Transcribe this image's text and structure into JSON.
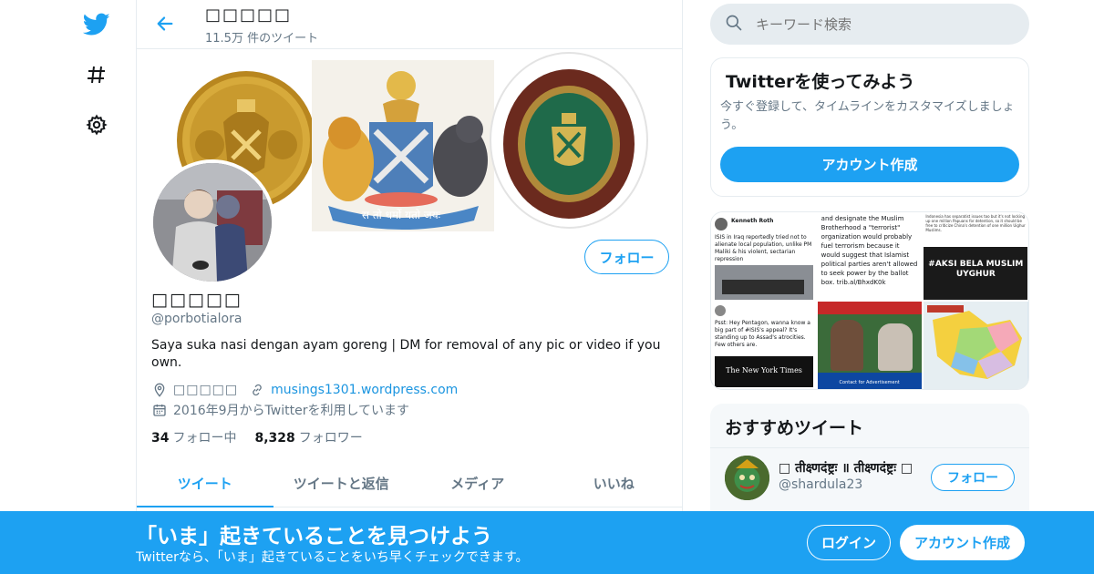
{
  "nav": {
    "items": [
      "twitter-logo",
      "explore-hashtag",
      "settings"
    ]
  },
  "header": {
    "name": "□□□□□",
    "tweet_count": "11.5万 件のツイート"
  },
  "profile": {
    "name": "□□□□□",
    "handle": "@porbotialora",
    "bio": "Saya suka nasi dengan ayam goreng | DM for removal of any pic or video if you own.",
    "location": "□□□□□",
    "url": "musings1301.wordpress.com",
    "joined": "2016年9月からTwitterを利用しています",
    "following_count": "34",
    "following_label": "フォロー中",
    "followers_count": "8,328",
    "followers_label": "フォロワー",
    "follow_label": "フォロー",
    "banner_motto": "स तो धर्मो यतो जयः"
  },
  "tabs": [
    {
      "label": "ツイート",
      "active": true
    },
    {
      "label": "ツイートと返信",
      "active": false
    },
    {
      "label": "メディア",
      "active": false
    },
    {
      "label": "いいね",
      "active": false
    }
  ],
  "search": {
    "placeholder": "キーワード検索"
  },
  "try_card": {
    "title": "Twitterを使ってみよう",
    "text": "今すぐ登録して、タイムラインをカスタマイズしましょう。",
    "button": "アカウント作成"
  },
  "media": {
    "cells": [
      {
        "type": "tweet-screenshot",
        "text": "ISIS in Iraq reportedly tried not to alienate local population, unlike PM Maliki & his violent, sectarian repression"
      },
      {
        "type": "tweet-screenshot",
        "text": "and designate the Muslim Brotherhood a \"terrorist\" organization would probably fuel terrorism because it would suggest that Islamist political parties aren't allowed to seek power by the ballot box. trib.al/BhxdK0k"
      },
      {
        "type": "poster",
        "text": "#AKSI BELA MUSLIM UYGHUR"
      },
      {
        "type": "tweet-screenshot",
        "text": "Psst: Hey Pentagon, wanna know a big part of #ISIS's appeal? It's standing up to Assad's atrocities. Few others are."
      },
      {
        "type": "news-photo",
        "text": "Contact for Advertisement"
      },
      {
        "type": "map",
        "text": ""
      }
    ],
    "nyt_label": "The New York Times"
  },
  "recommended": {
    "title": "おすすめツイート",
    "name": "□ तीक्ष्णदंष्ट्रः ॥ तीक्ष्णदंष्ट्रः □",
    "handle": "@shardula23",
    "follow_label": "フォロー"
  },
  "bottom": {
    "title": "「いま」起きていることを見つけよう",
    "subtitle": "Twitterなら、「いま」起きていることをいち早くチェックできます。",
    "login": "ログイン",
    "signup": "アカウント作成"
  },
  "colors": {
    "accent": "#1da1f2",
    "muted": "#657786",
    "border": "#e6ecf0"
  }
}
